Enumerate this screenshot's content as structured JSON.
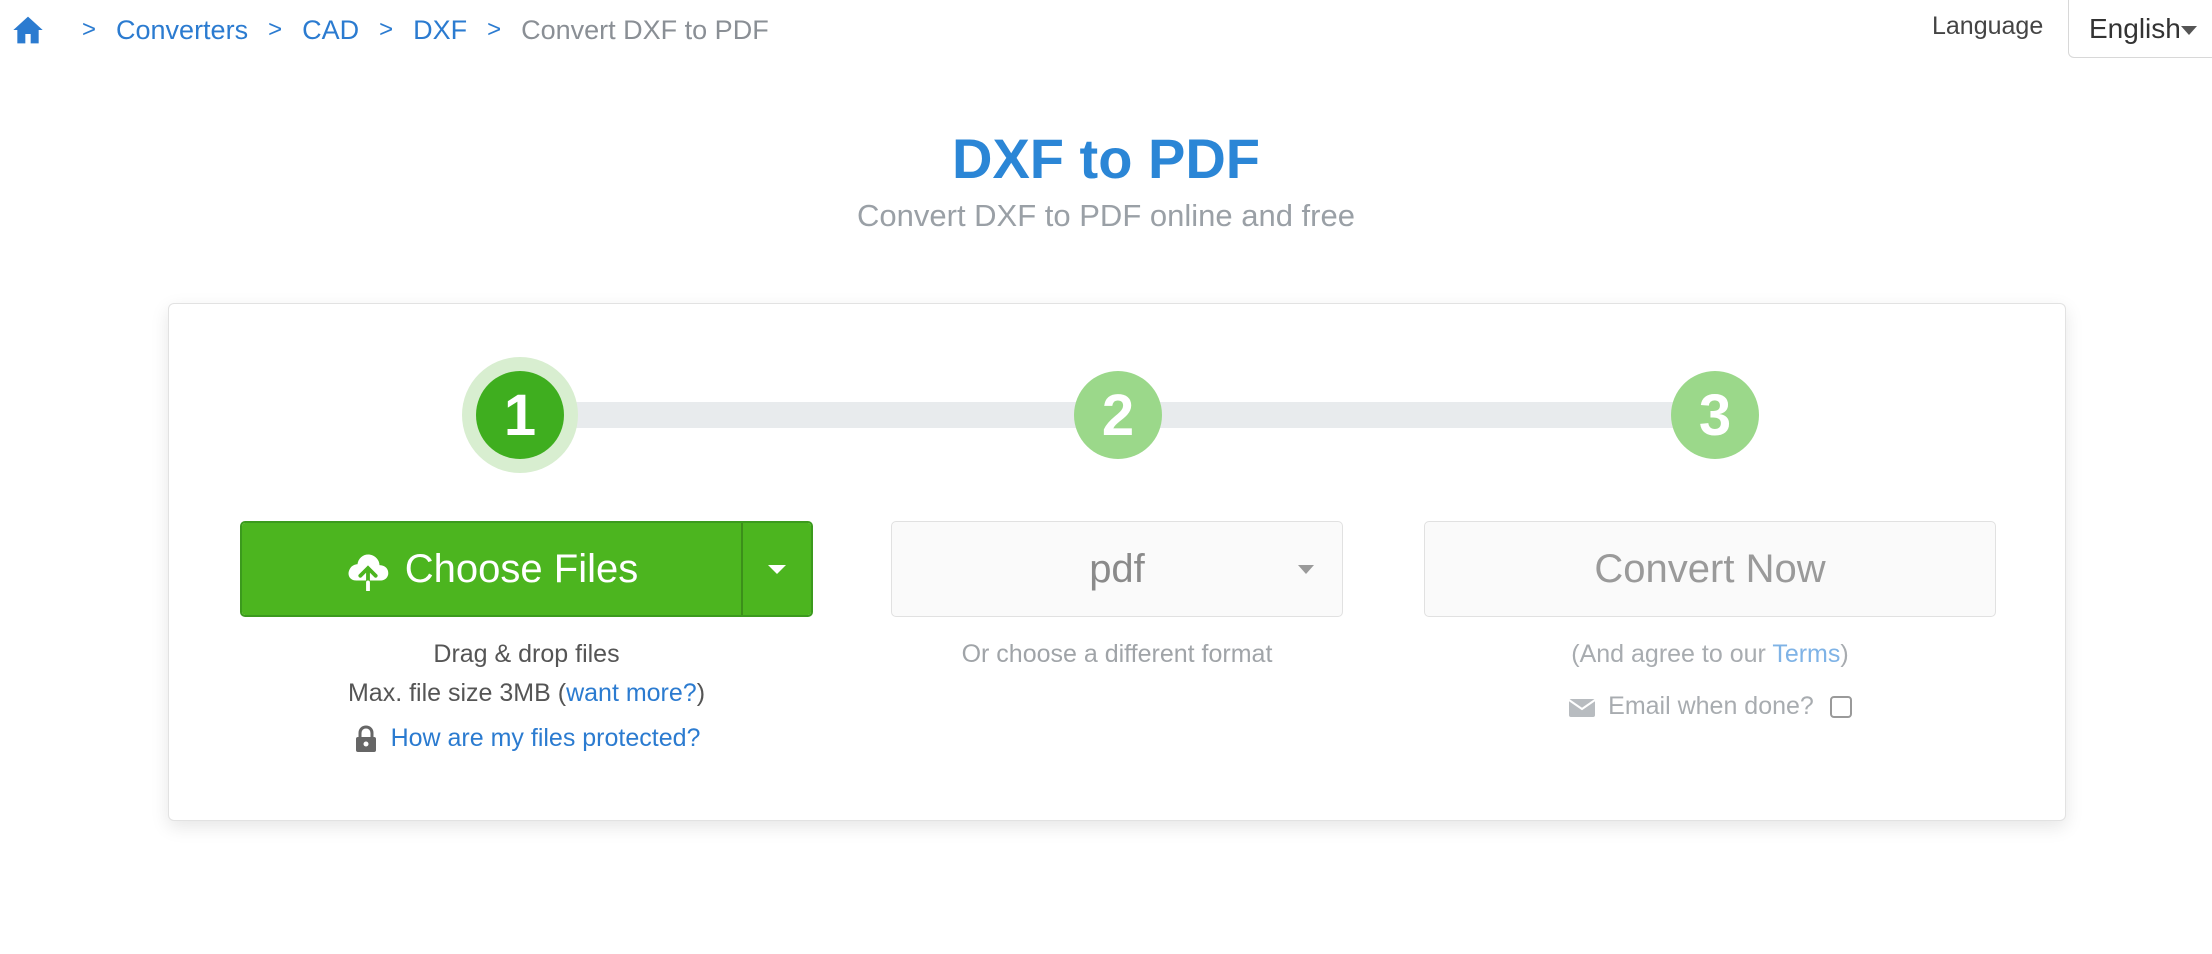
{
  "breadcrumb": {
    "items": [
      "Converters",
      "CAD",
      "DXF"
    ],
    "separator": ">",
    "current": "Convert DXF to PDF"
  },
  "language": {
    "label": "Language",
    "selected": "English"
  },
  "hero": {
    "title": "DXF to PDF",
    "subtitle": "Convert DXF to PDF online and free"
  },
  "steps": [
    "1",
    "2",
    "3"
  ],
  "upload": {
    "button_label": "Choose Files",
    "drag_text": "Drag & drop files",
    "max_size_text": "Max. file size 3MB (",
    "want_more_link": "want more?",
    "max_size_close": ")",
    "protect_link": "How are my files protected?"
  },
  "format": {
    "selected": "pdf",
    "hint": "Or choose a different format"
  },
  "convert": {
    "button_label": "Convert Now",
    "terms_prefix": "(And agree to our ",
    "terms_link": "Terms",
    "terms_suffix": ")",
    "email_label": "Email when done?"
  },
  "colors": {
    "brand_blue": "#2b86d6",
    "green": "#4cb51f",
    "step_pending": "#9bd88a"
  },
  "icons": [
    "home-icon",
    "upload-cloud-icon",
    "lock-icon",
    "mail-icon",
    "chevron-down-icon"
  ]
}
